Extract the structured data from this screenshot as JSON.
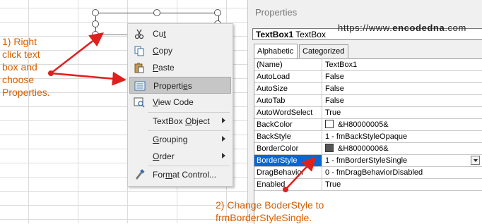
{
  "textbox": {
    "label": "textbox"
  },
  "context_menu": {
    "items": [
      {
        "label": "Cut",
        "icon": "scissors-icon",
        "underline_index": 2
      },
      {
        "label": "Copy",
        "icon": "copy-icon",
        "underline_index": 0
      },
      {
        "label": "Paste",
        "icon": "paste-icon",
        "underline_index": 0
      },
      {
        "label": "Properties",
        "icon": "properties-icon",
        "underline_index": 8,
        "selected": true
      },
      {
        "label": "View Code",
        "icon": "view-code-icon",
        "underline_index": 0
      },
      {
        "label": "TextBox Object",
        "submenu": true,
        "underline_index": 8
      },
      {
        "label": "Grouping",
        "submenu": true,
        "underline_index": 0
      },
      {
        "label": "Order",
        "submenu": true,
        "underline_index": 0
      },
      {
        "label": "Format Control...",
        "icon": "format-control-icon",
        "underline_index": 3
      }
    ]
  },
  "properties": {
    "title": "Properties",
    "object_name": "TextBox1",
    "object_type": "TextBox",
    "tabs": [
      "Alphabetic",
      "Categorized"
    ],
    "rows": [
      {
        "name": "(Name)",
        "value": "TextBox1"
      },
      {
        "name": "AutoLoad",
        "value": "False"
      },
      {
        "name": "AutoSize",
        "value": "False"
      },
      {
        "name": "AutoTab",
        "value": "False"
      },
      {
        "name": "AutoWordSelect",
        "value": "True"
      },
      {
        "name": "BackColor",
        "value": "&H80000005&",
        "swatch": "#ffffff"
      },
      {
        "name": "BackStyle",
        "value": "1 - fmBackStyleOpaque"
      },
      {
        "name": "BorderColor",
        "value": "&H80000006&",
        "swatch": "#555555"
      },
      {
        "name": "BorderStyle",
        "value": "1 - fmBorderStyleSingle",
        "selected": true
      },
      {
        "name": "DragBehavior",
        "value": "0 - fmDragBehaviorDisabled"
      },
      {
        "name": "Enabled",
        "value": "True"
      }
    ]
  },
  "watermark": {
    "prefix": "https://www.",
    "brand": "encodedna",
    "suffix": ".com"
  },
  "annotations": {
    "step1": "1) Right click text box and choose Properties.",
    "step2_line1": "2) Change BoderStyle to",
    "step2_line2": "frmBorderStyleSingle."
  },
  "colors": {
    "annotation": "#d45f00",
    "arrow": "#e0201e",
    "selection": "#0a66d4"
  }
}
